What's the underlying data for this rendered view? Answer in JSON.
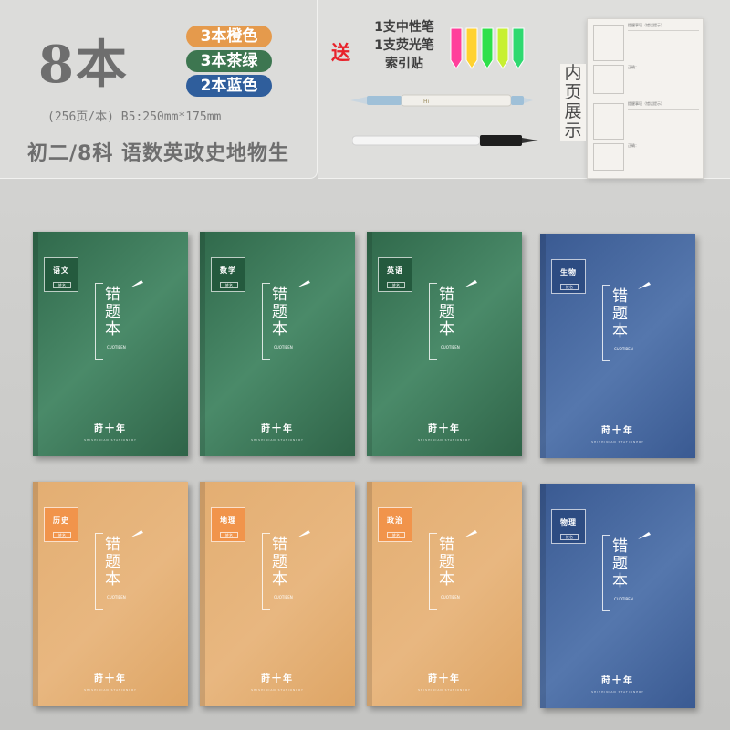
{
  "header": {
    "count_label": "8本",
    "color_options": [
      "3本橙色",
      "3本茶绿",
      "2本蓝色"
    ],
    "spec": "(256页/本) B5:250mm*175mm",
    "grade_line": "初二/8科 语数英政史地物生"
  },
  "gift": {
    "label": "送",
    "items": [
      "1支中性笔",
      "1支荧光笔",
      "索引贴"
    ],
    "flag_colors": [
      "#ff3f9b",
      "#ffd230",
      "#2ee04a",
      "#c7f032",
      "#2fd970"
    ]
  },
  "inner_page": {
    "label": "内页展示",
    "field_1": "提醒事项（错误提示）",
    "field_2": "正确：",
    "field_3": "提醒事项（错误提示）",
    "field_4": "正确："
  },
  "notebooks": [
    {
      "subject": "语文",
      "color": "green"
    },
    {
      "subject": "数学",
      "color": "green"
    },
    {
      "subject": "英语",
      "color": "green"
    },
    {
      "subject": "生物",
      "color": "blue"
    },
    {
      "subject": "历史",
      "color": "orange"
    },
    {
      "subject": "地理",
      "color": "orange"
    },
    {
      "subject": "政治",
      "color": "orange"
    },
    {
      "subject": "物理",
      "color": "blue"
    }
  ],
  "cover": {
    "title": "错题本",
    "subtitle_en": "CUOTIBEN",
    "brand": "莳十年",
    "brand_sub": "SHISHINIAN STATIONERY",
    "name_field": "姓名"
  },
  "colors": {
    "green": "#3d7650",
    "blue": "#2f5e9c",
    "orange": "#e59a4c",
    "red_accent": "#e8222b"
  }
}
